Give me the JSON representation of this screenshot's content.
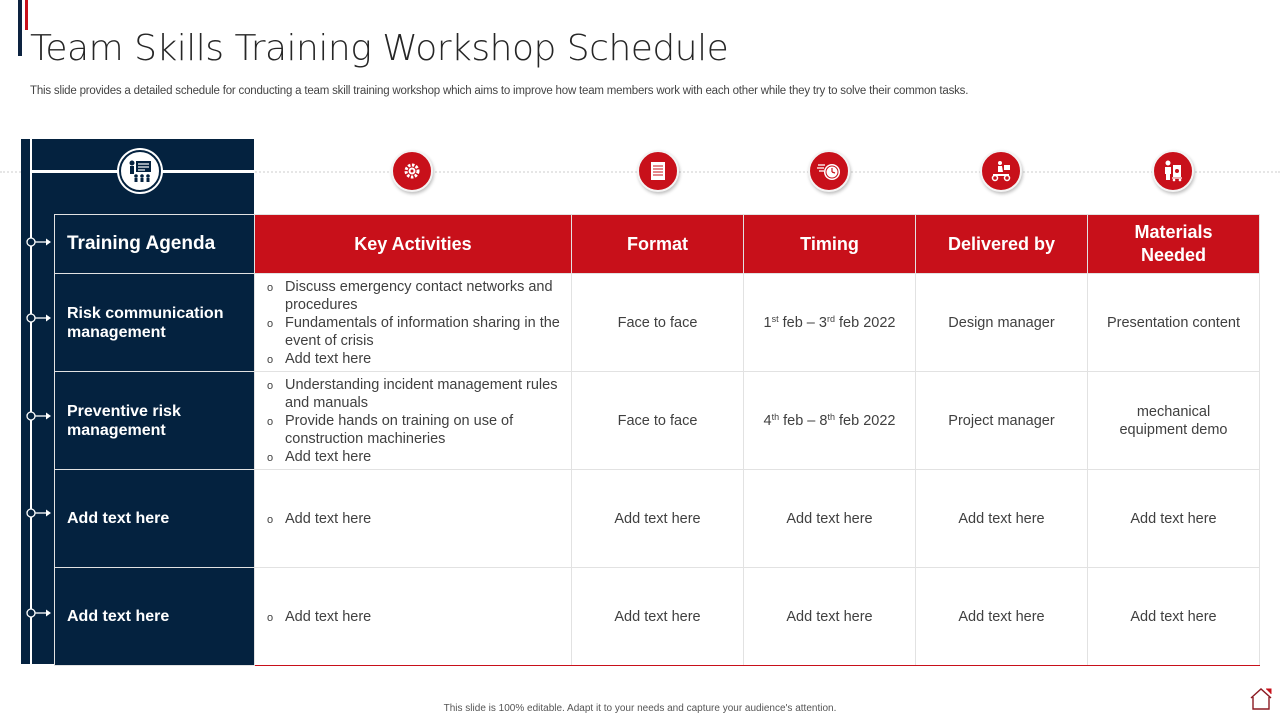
{
  "header": {
    "title": "Team Skills Training Workshop Schedule",
    "subtitle": "This slide provides a detailed schedule for conducting a team skill training workshop which aims to improve how team members work with each other while they try  to solve their common tasks."
  },
  "icons": {
    "agenda": "presentation-icon",
    "columns": [
      "gear-icon",
      "document-icon",
      "clock-icon",
      "delivery-scooter-icon",
      "worker-cart-icon"
    ]
  },
  "table": {
    "agenda_header": "Training Agenda",
    "columns": [
      "Key Activities",
      "Format",
      "Timing",
      "Delivered by",
      "Materials Needed"
    ],
    "rows": [
      {
        "agenda": "Risk communication management",
        "activities": [
          "Discuss emergency contact networks and procedures",
          "Fundamentals of information sharing in the event of crisis",
          "Add text here"
        ],
        "format": "Face to face",
        "timing": {
          "start_day": "1",
          "start_suffix": "st",
          "start_rest": " feb – ",
          "end_day": "3",
          "end_suffix": "rd",
          "end_rest": " feb 2022"
        },
        "delivered_by": "Design manager",
        "materials": "Presentation content"
      },
      {
        "agenda": "Preventive risk management",
        "activities": [
          "Understanding incident management rules and manuals",
          "Provide hands on training on use of construction machineries",
          "Add text here"
        ],
        "format": "Face to face",
        "timing": {
          "start_day": "4",
          "start_suffix": "th",
          "start_rest": " feb – ",
          "end_day": "8",
          "end_suffix": "th",
          "end_rest": " feb 2022"
        },
        "delivered_by": "Project manager",
        "materials": "mechanical equipment demo"
      },
      {
        "agenda": "Add text here",
        "activities": [
          "Add text here"
        ],
        "format": "Add text here",
        "timing_text": "Add text here",
        "delivered_by": "Add text here",
        "materials": "Add text here"
      },
      {
        "agenda": "Add text here",
        "activities": [
          "Add text here"
        ],
        "format": "Add text here",
        "timing_text": "Add text here",
        "delivered_by": "Add text here",
        "materials": "Add text here"
      }
    ],
    "bullet_glyph": "o"
  },
  "footer": {
    "note": "This slide is 100% editable.  Adapt it to your needs and capture your audience's attention."
  },
  "colors": {
    "navy": "#04223f",
    "red": "#c8101a"
  }
}
